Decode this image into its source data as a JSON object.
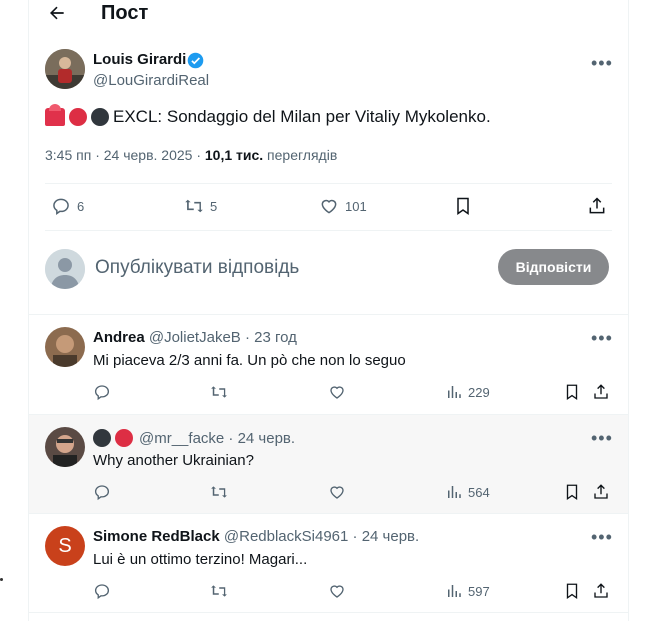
{
  "header": {
    "title": "Пост"
  },
  "post": {
    "author_name": "Louis Girardi",
    "author_handle": "@LouGirardiReal",
    "text": "EXCL: Sondaggio del Milan per Vitaliy Mykolenko.",
    "time": "3:45 пп · 24 черв. 2025 ·",
    "views_count": "10,1 тис.",
    "views_label": "переглядів",
    "stats": {
      "replies": "6",
      "reposts": "5",
      "likes": "101"
    },
    "colors": {
      "accent": "#1d9bf0",
      "red_emoji": "#dd2e44",
      "black_emoji": "#31373d"
    }
  },
  "compose": {
    "placeholder": "Опублікувати відповідь",
    "button": "Відповісти"
  },
  "replies": [
    {
      "name": "Andrea",
      "handle": "@JolietJakeB · 23 год",
      "text": "Mi piaceva 2/3 anni fa. Un pò che non lo seguo",
      "views": "229"
    },
    {
      "name": "",
      "handle": "@mr__facke · 24 черв.",
      "text": "Why another Ukrainian?",
      "views": "564"
    },
    {
      "name": "Simone RedBlack",
      "handle": "@RedblackSi4961 · 24 черв.",
      "text": "Lui è un ottimo terzino! Magari...",
      "views": "597",
      "avatar_letter": "S"
    }
  ]
}
